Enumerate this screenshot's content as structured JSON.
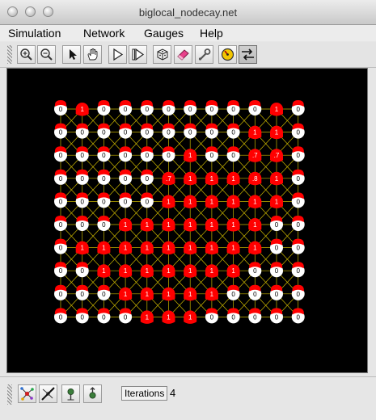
{
  "window": {
    "title": "biglocal_nodecay.net"
  },
  "menus": [
    "Simulation",
    "Network",
    "Gauges",
    "Help"
  ],
  "toolbar": {
    "buttons": [
      {
        "name": "zoom-in-button",
        "icon": "zoom-in-icon"
      },
      {
        "name": "zoom-out-button",
        "icon": "zoom-out-icon"
      },
      {
        "name": "select-button",
        "icon": "arrow-pointer-icon"
      },
      {
        "name": "pan-button",
        "icon": "hand-icon"
      },
      {
        "name": "run-button",
        "icon": "play-icon"
      },
      {
        "name": "step-button",
        "icon": "step-forward-icon"
      },
      {
        "name": "randomize-button",
        "icon": "dice-icon"
      },
      {
        "name": "eraser-button",
        "icon": "eraser-icon"
      },
      {
        "name": "settings-button",
        "icon": "wrench-icon"
      },
      {
        "name": "gauge-button",
        "icon": "gauge-icon"
      },
      {
        "name": "toggle-button",
        "icon": "opposing-arrows-icon"
      }
    ]
  },
  "network": {
    "colors": {
      "active": "#ff0000",
      "inactive": "#ffffff",
      "edge": "#c8b400",
      "background": "#000000"
    },
    "rows": [
      [
        "0",
        "1",
        "0",
        "0",
        "0",
        "0",
        "0",
        "0",
        "0",
        "0",
        "1",
        "0"
      ],
      [
        "0",
        "0",
        "0",
        "0",
        "0",
        "0",
        "0",
        "0",
        "0",
        "1",
        "1",
        "0"
      ],
      [
        "0",
        "0",
        "0",
        "0",
        "0",
        "0",
        "1",
        "0",
        "0",
        ".7",
        ".7",
        "0"
      ],
      [
        "0",
        "0",
        "0",
        "0",
        "0",
        ".7",
        "1",
        "1",
        "1",
        ".8",
        "1",
        "0"
      ],
      [
        "0",
        "0",
        "0",
        "0",
        "0",
        "1",
        "1",
        "1",
        "1",
        "1",
        "1",
        "0"
      ],
      [
        "0",
        "0",
        "0",
        "1",
        "1",
        "1",
        "1",
        "1",
        "1",
        "1",
        "0",
        "0"
      ],
      [
        "0",
        "1",
        "1",
        "1",
        "1",
        "1",
        "1",
        "1",
        "1",
        "1",
        "0",
        "0"
      ],
      [
        "0",
        "0",
        "1",
        "1",
        "1",
        "1",
        "1",
        "1",
        "1",
        "0",
        "0",
        "0"
      ],
      [
        "0",
        "0",
        "0",
        "1",
        "1",
        "1",
        "1",
        "1",
        "0",
        "0",
        "0",
        "0"
      ],
      [
        "0",
        "0",
        "0",
        "0",
        "1",
        "1",
        "1",
        "0",
        "0",
        "0",
        "0",
        "0"
      ]
    ]
  },
  "status": {
    "tools": [
      {
        "name": "network-tool-button",
        "icon": "network-icon"
      },
      {
        "name": "clear-network-tool-button",
        "icon": "crossed-network-icon"
      },
      {
        "name": "pin-tool-button",
        "icon": "pin-icon"
      },
      {
        "name": "probe-tool-button",
        "icon": "probe-icon"
      }
    ],
    "iterations_label": "Iterations",
    "iterations_value": "4"
  }
}
